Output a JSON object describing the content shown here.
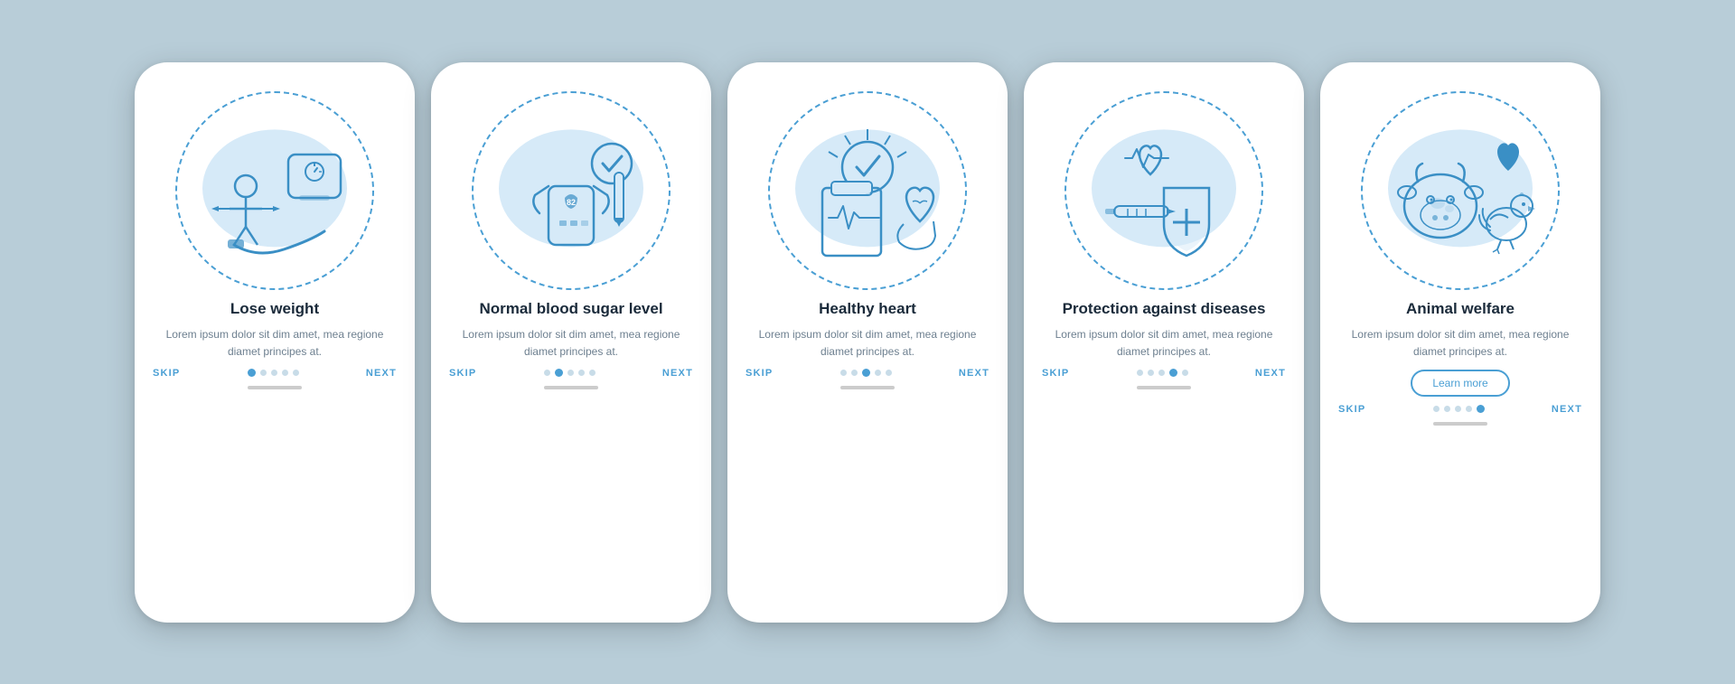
{
  "screens": [
    {
      "id": "lose-weight",
      "title": "Lose weight",
      "body": "Lorem ipsum dolor sit dim amet, mea regione diamet principes at.",
      "dots": [
        true,
        false,
        false,
        false,
        false
      ],
      "activeIndex": 0,
      "showLearnMore": false,
      "skip_label": "SKIP",
      "next_label": "NEXT"
    },
    {
      "id": "blood-sugar",
      "title": "Normal blood sugar level",
      "body": "Lorem ipsum dolor sit dim amet, mea regione diamet principes at.",
      "dots": [
        false,
        true,
        false,
        false,
        false
      ],
      "activeIndex": 1,
      "showLearnMore": false,
      "skip_label": "SKIP",
      "next_label": "NEXT"
    },
    {
      "id": "healthy-heart",
      "title": "Healthy heart",
      "body": "Lorem ipsum dolor sit dim amet, mea regione diamet principes at.",
      "dots": [
        false,
        false,
        true,
        false,
        false
      ],
      "activeIndex": 2,
      "showLearnMore": false,
      "skip_label": "SKIP",
      "next_label": "NEXT"
    },
    {
      "id": "protection",
      "title": "Protection against diseases",
      "body": "Lorem ipsum dolor sit dim amet, mea regione diamet principes at.",
      "dots": [
        false,
        false,
        false,
        true,
        false
      ],
      "activeIndex": 3,
      "showLearnMore": false,
      "skip_label": "SKIP",
      "next_label": "NEXT"
    },
    {
      "id": "animal-welfare",
      "title": "Animal welfare",
      "body": "Lorem ipsum dolor sit dim amet, mea regione diamet principes at.",
      "dots": [
        false,
        false,
        false,
        false,
        true
      ],
      "activeIndex": 4,
      "showLearnMore": true,
      "learn_more_label": "Learn more",
      "skip_label": "SKIP",
      "next_label": "NEXT"
    }
  ]
}
